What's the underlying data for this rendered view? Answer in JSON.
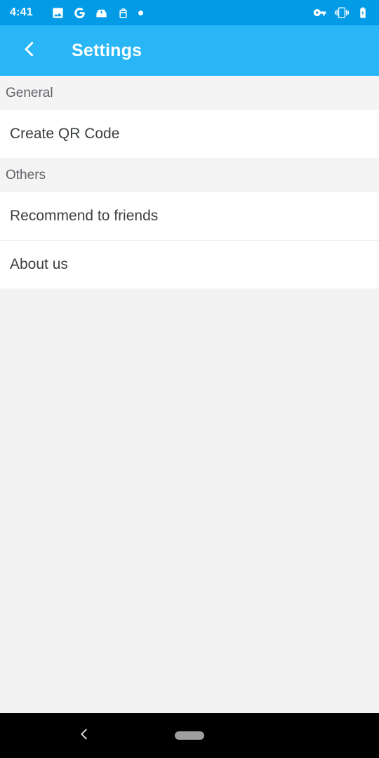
{
  "status_bar": {
    "time": "4:41",
    "background_color": "#039BE5",
    "left_icons": [
      {
        "name": "photo-image-icon",
        "label": "Image"
      },
      {
        "name": "google-g-icon",
        "label": "G"
      },
      {
        "name": "drive-save-icon",
        "label": "Save to drive"
      },
      {
        "name": "clipboard-outline-icon",
        "label": "Clipboard"
      },
      {
        "name": "notification-dot-icon",
        "label": "Notification"
      }
    ],
    "right_icons": [
      {
        "name": "vpn-key-icon",
        "label": "VPN"
      },
      {
        "name": "vibrate-icon",
        "label": "Vibrate"
      },
      {
        "name": "battery-charging-icon",
        "label": "Battery charging"
      }
    ]
  },
  "app_bar": {
    "title": "Settings",
    "back_icon": "chevron-left-icon",
    "background_color": "#29B6F6",
    "title_color": "#FFFFFF"
  },
  "sections": [
    {
      "header": "General",
      "items": [
        {
          "label": "Create QR Code"
        }
      ]
    },
    {
      "header": "Others",
      "items": [
        {
          "label": "Recommend to friends"
        },
        {
          "label": "About us"
        }
      ]
    }
  ],
  "nav_bar": {
    "background_color": "#000000",
    "back_icon": "chevron-left-icon",
    "home_handle": "home-pill-handle"
  }
}
